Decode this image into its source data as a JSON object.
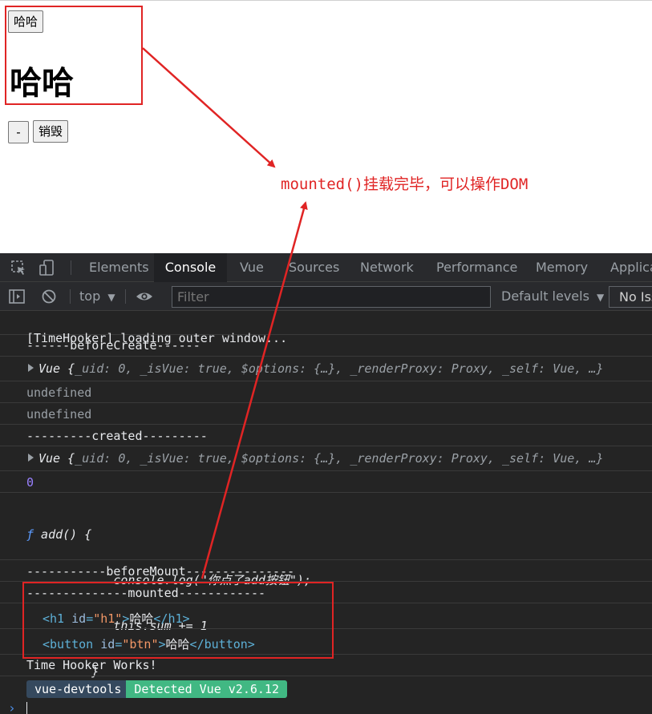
{
  "page": {
    "button_top": "哈哈",
    "heading": "哈哈",
    "button_minus": "-",
    "button_destroy": "销毁",
    "annotation": "mounted()挂载完毕，可以操作DOM",
    "annotation_color": "#e02424"
  },
  "devtools": {
    "tabs": [
      "Elements",
      "Console",
      "Vue",
      "Sources",
      "Network",
      "Performance",
      "Memory",
      "Applica"
    ],
    "active_tab": "Console",
    "toolbar": {
      "context": "top",
      "filter_placeholder": "Filter",
      "levels": "Default levels",
      "issues": "No Iss"
    },
    "console": {
      "l1": "[TimeHooker] loading outer window...",
      "l2": "------beforeCreate------",
      "l3_prefix": "Vue {",
      "l3_body": "_uid: 0, _isVue: true, $options: {…}, _renderProxy: Proxy, _self: Vue, …}",
      "l4": "undefined",
      "l5": "undefined",
      "l6": "---------created---------",
      "l7_prefix": "Vue {",
      "l7_body": "_uid: 0, _isVue: true, $options: {…}, _renderProxy: Proxy, _self: Vue, …}",
      "l8": "0",
      "fn_kw": "ƒ",
      "fn_l1": " add() {",
      "fn_l2": "            console.log(\"你点了add按钮\");",
      "fn_l3": "            this.sum += 1",
      "fn_l4": "         }",
      "l10": "-----------beforeMount---------------",
      "l11": "--------------mounted------------",
      "h1_open": "<h1 ",
      "h1_attr_name": "id",
      "h1_attr_val": "\"h1\"",
      "h1_close_open": ">",
      "h1_text": "哈哈",
      "h1_close": "</h1>",
      "btn_open": "<button ",
      "btn_attr_name": "id",
      "btn_attr_val": "\"btn\"",
      "btn_close_open": ">",
      "btn_text": "哈哈",
      "btn_close": "</button>",
      "l14": "Time Hooker Works!",
      "badge_left": "vue-devtools",
      "badge_right": "Detected Vue v2.6.12",
      "prompt": "›"
    }
  }
}
